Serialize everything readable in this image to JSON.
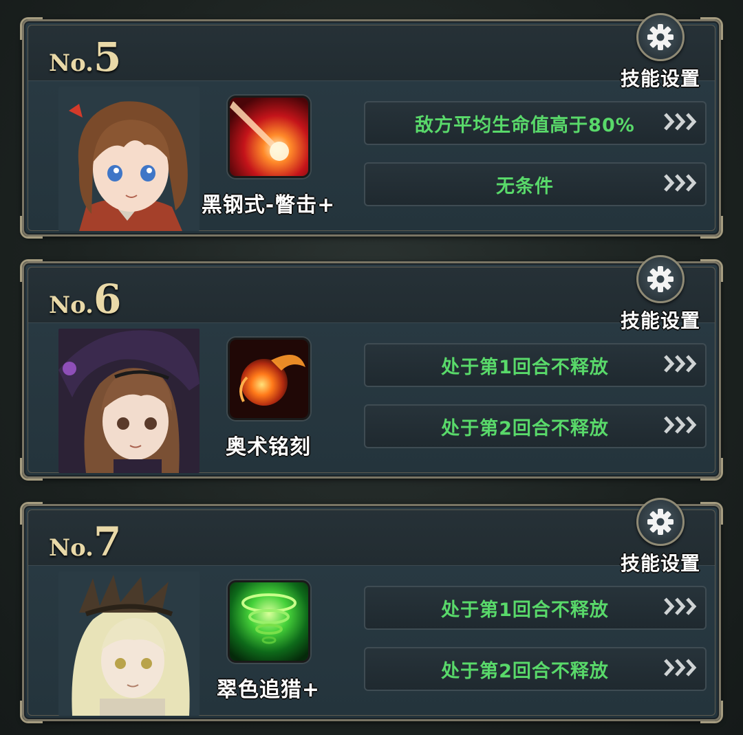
{
  "cards": [
    {
      "no_prefix": "No.",
      "no_number": "5",
      "settings_label": "技能设置",
      "skill_name": "黑钢式-瞥击+",
      "conditions": [
        "敌方平均生命值高于80%",
        "无条件"
      ]
    },
    {
      "no_prefix": "No.",
      "no_number": "6",
      "settings_label": "技能设置",
      "skill_name": "奥术铭刻",
      "conditions": [
        "处于第1回合不释放",
        "处于第2回合不释放"
      ]
    },
    {
      "no_prefix": "No.",
      "no_number": "7",
      "settings_label": "技能设置",
      "skill_name": "翠色追猎+",
      "conditions": [
        "处于第1回合不释放",
        "处于第2回合不释放"
      ]
    }
  ],
  "colors": {
    "condition_text": "#59d96a",
    "number_gold": "#e9d9a8",
    "frame": "#7a7564"
  },
  "icons": {
    "settings": "gear-icon",
    "condition_arrow": "triple-chevron-right-icon",
    "skill_1": "red-slash-skill-icon",
    "skill_2": "fireball-skill-icon",
    "skill_3": "green-tornado-skill-icon"
  }
}
